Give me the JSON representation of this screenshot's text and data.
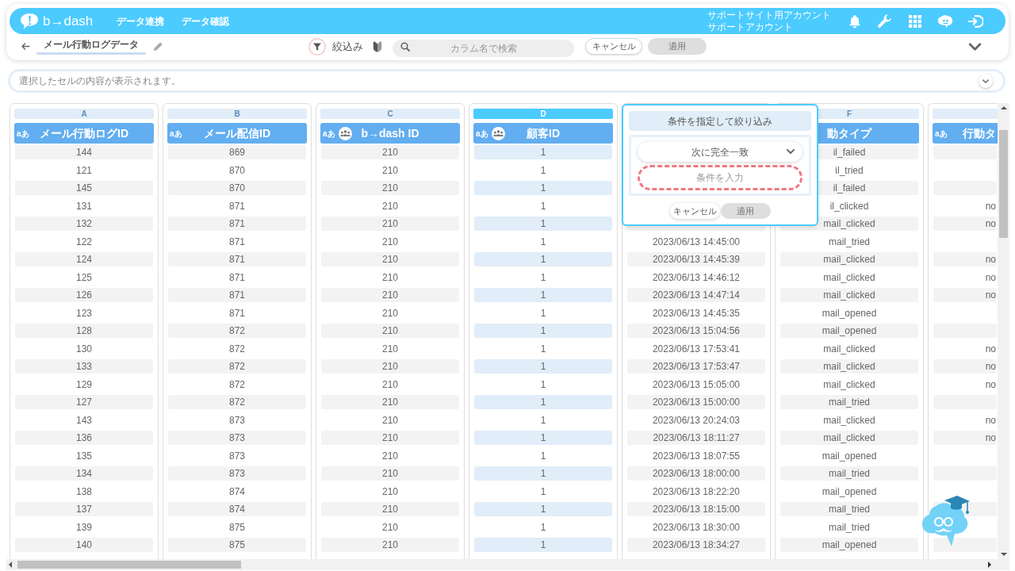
{
  "header": {
    "logo_text": "b→dash",
    "nav": [
      "データ連携",
      "データ確認"
    ],
    "account": [
      "サポートサイト用アカウント",
      "サポートアカウント"
    ]
  },
  "toolbar": {
    "title": "メール行動ログデータ",
    "filter_label": "絞込み",
    "search": {
      "placeholder": "カラム名で検索"
    },
    "buttons": [
      {
        "kind": "cancel",
        "label": "キャンセル",
        "disabled": false
      },
      {
        "kind": "apply",
        "label": "適用",
        "disabled": true
      }
    ]
  },
  "cell_viewer": {
    "placeholder": "選択したセルの内容が表示されます。"
  },
  "table": {
    "columns": [
      {
        "letter": "A",
        "type_label": "aあ",
        "title": "メール行動ログID",
        "people_icon": false,
        "selected": false
      },
      {
        "letter": "B",
        "type_label": "aあ",
        "title": "メール配信ID",
        "people_icon": false,
        "selected": false
      },
      {
        "letter": "C",
        "type_label": "aあ",
        "title": "b→dash ID",
        "people_icon": true,
        "selected": false
      },
      {
        "letter": "D",
        "type_label": "aあ",
        "title": "顧客ID",
        "people_icon": true,
        "selected": true
      },
      {
        "selected": false
      },
      {
        "letter": "F",
        "title": "動タイプ",
        "selected": false
      },
      {
        "type_label": "aあ",
        "title": "行動タ",
        "people_icon": false,
        "selected": false
      }
    ],
    "rows": [
      [
        "144",
        "869",
        "210",
        "1",
        null,
        "il_failed",
        null
      ],
      [
        "121",
        "870",
        "210",
        "1",
        null,
        "il_tried",
        null
      ],
      [
        "145",
        "870",
        "210",
        "1",
        null,
        "il_failed",
        null
      ],
      [
        "131",
        "871",
        "210",
        "1",
        null,
        "il_clicked",
        "no"
      ],
      [
        "132",
        "871",
        "210",
        "1",
        null,
        "mail_clicked",
        "no"
      ],
      [
        "122",
        "871",
        "210",
        "1",
        "2023/06/13 14:45:00",
        "mail_tried",
        null
      ],
      [
        "124",
        "871",
        "210",
        "1",
        "2023/06/13 14:45:39",
        "mail_clicked",
        "no"
      ],
      [
        "125",
        "871",
        "210",
        "1",
        "2023/06/13 14:46:12",
        "mail_clicked",
        "no"
      ],
      [
        "126",
        "871",
        "210",
        "1",
        "2023/06/13 14:47:14",
        "mail_clicked",
        "no"
      ],
      [
        "123",
        "871",
        "210",
        "1",
        "2023/06/13 14:45:35",
        "mail_opened",
        null
      ],
      [
        "128",
        "872",
        "210",
        "1",
        "2023/06/13 15:04:56",
        "mail_opened",
        null
      ],
      [
        "130",
        "872",
        "210",
        "1",
        "2023/06/13 17:53:41",
        "mail_clicked",
        "no"
      ],
      [
        "133",
        "872",
        "210",
        "1",
        "2023/06/13 17:53:47",
        "mail_clicked",
        "no"
      ],
      [
        "129",
        "872",
        "210",
        "1",
        "2023/06/13 15:05:00",
        "mail_clicked",
        "no"
      ],
      [
        "127",
        "872",
        "210",
        "1",
        "2023/06/13 15:00:00",
        "mail_tried",
        null
      ],
      [
        "143",
        "873",
        "210",
        "1",
        "2023/06/13 20:24:03",
        "mail_clicked",
        "no"
      ],
      [
        "136",
        "873",
        "210",
        "1",
        "2023/06/13 18:11:27",
        "mail_clicked",
        "no"
      ],
      [
        "135",
        "873",
        "210",
        "1",
        "2023/06/13 18:07:55",
        "mail_opened",
        null
      ],
      [
        "134",
        "873",
        "210",
        "1",
        "2023/06/13 18:00:00",
        "mail_tried",
        null
      ],
      [
        "138",
        "874",
        "210",
        "1",
        "2023/06/13 18:22:20",
        "mail_opened",
        null
      ],
      [
        "137",
        "874",
        "210",
        "1",
        "2023/06/13 18:15:00",
        "mail_tried",
        null
      ],
      [
        "139",
        "875",
        "210",
        "1",
        "2023/06/13 18:30:00",
        "mail_tried",
        null
      ],
      [
        "140",
        "875",
        "210",
        "1",
        "2023/06/13 18:34:27",
        "mail_opened",
        null
      ]
    ]
  },
  "filter_popup": {
    "title": "条件を指定して絞り込み",
    "operator": "次に完全一致",
    "condition": {
      "placeholder": "条件を入力",
      "invalid": true
    },
    "buttons": [
      {
        "kind": "cancel",
        "label": "キャンセル",
        "disabled": false
      },
      {
        "kind": "apply",
        "label": "適用",
        "disabled": true
      }
    ]
  }
}
